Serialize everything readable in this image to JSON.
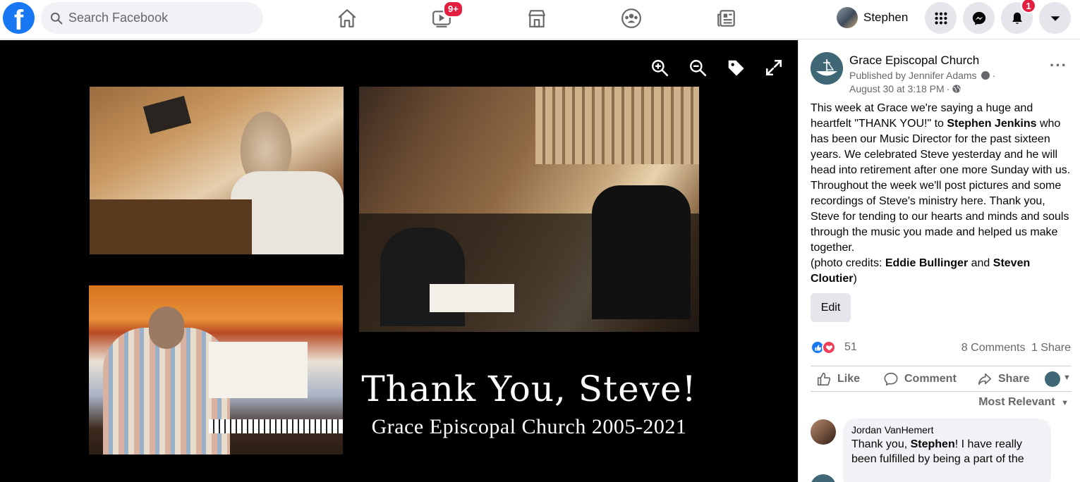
{
  "topbar": {
    "search_placeholder": "Search Facebook",
    "video_badge": "9+",
    "profile_name": "Stephen",
    "notifications_badge": "1",
    "brand_color": "#1877f2"
  },
  "viewer": {
    "title": "Thank You, Steve!",
    "subtitle": "Grace Episcopal Church 2005-2021"
  },
  "post": {
    "page_name": "Grace Episcopal Church",
    "published_by": "Published by Jennifer Adams",
    "date": "August 30 at 3:18 PM",
    "text_intro": "This week at Grace we're saying a huge and heartfelt \"THANK YOU!\" to ",
    "mention_1": "Stephen Jenkins",
    "text_body": " who has been our Music Director for the past sixteen years. We celebrated Steve yesterday and he will head into retirement after one more Sunday with us. Throughout the week we'll post pictures and some recordings of Steve's ministry here. Thank you, Steve for tending to our hearts and minds and souls through the music you made and helped us make together.",
    "credits_prefix": "(photo credits: ",
    "credit_1": "Eddie Bullinger",
    "credits_and": " and ",
    "credit_2": "Steven Cloutier",
    "credits_suffix": ")",
    "edit_label": "Edit",
    "reaction_count": "51",
    "comments_count": "8 Comments",
    "shares_count": "1 Share",
    "like_label": "Like",
    "comment_label": "Comment",
    "share_label": "Share",
    "sort_label": "Most Relevant"
  },
  "comments": [
    {
      "author": "Jordan VanHemert",
      "text_prefix": "Thank you, ",
      "mention": "Stephen",
      "text_suffix": "! I have really been fulfilled by being a part of the"
    }
  ]
}
